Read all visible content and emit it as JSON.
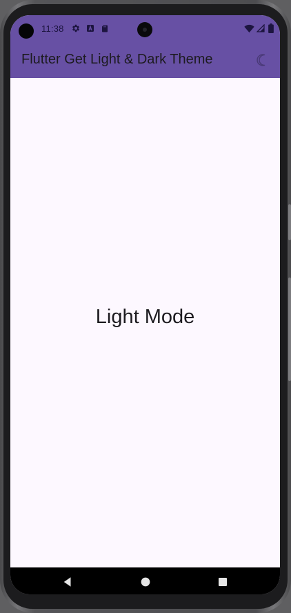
{
  "status_bar": {
    "time": "11:38",
    "left_icons": [
      "gear-icon",
      "a-badge-icon",
      "sd-card-icon"
    ],
    "right_icons": [
      "wifi-icon",
      "signal-icon",
      "battery-icon"
    ]
  },
  "app_bar": {
    "title": "Flutter Get Light & Dark Theme",
    "action_icon": "moon-icon"
  },
  "body": {
    "mode_text": "Light Mode"
  },
  "nav_bar": {
    "buttons": [
      "back-icon",
      "home-icon",
      "recents-icon"
    ]
  },
  "colors": {
    "primary": "#6750a4",
    "background": "#fdf8ff",
    "on_surface": "#1d1b20",
    "nav_bar": "#000000"
  }
}
